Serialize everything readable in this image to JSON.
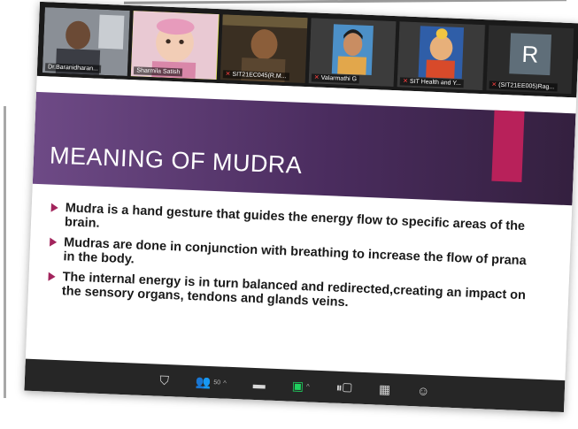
{
  "participants": [
    {
      "name": "Dr.Baranidharan...",
      "muted": false,
      "type": "man"
    },
    {
      "name": "Sharmila Satish",
      "muted": false,
      "type": "baby",
      "active": true
    },
    {
      "name": "SIT21EC045(R.M...",
      "muted": true,
      "type": "poster"
    },
    {
      "name": "Valarmathi G",
      "muted": true,
      "type": "woman"
    },
    {
      "name": "SIT Health and Y...",
      "muted": true,
      "type": "deity"
    },
    {
      "name": "(SIT21EE005)Rag...",
      "muted": true,
      "type": "initial",
      "initial": "R"
    }
  ],
  "slide": {
    "title": "MEANING OF MUDRA",
    "bullets": [
      "Mudra is a hand gesture that guides the energy flow to specific areas of the brain.",
      "Mudras are done in conjunction with breathing to increase the flow of prana in the body.",
      "The internal energy is in turn balanced and redirected,creating an impact on the sensory organs, tendons and glands veins."
    ]
  },
  "toolbar": {
    "participant_count": "50",
    "icons": [
      "security-icon",
      "participants-icon",
      "chat-icon",
      "share-screen-icon",
      "record-icon",
      "breakout-icon",
      "reactions-icon"
    ]
  }
}
